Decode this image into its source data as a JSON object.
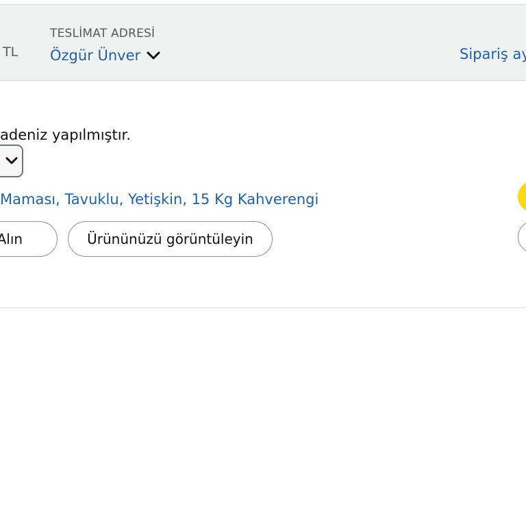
{
  "order_header": {
    "total_fragment": "TL",
    "ship_to_label": "TESLİMAT ADRESİ",
    "ship_to_name": "Özgür Ünver",
    "ship_to_icon": "chevron-down-icon",
    "order_details_link": "Sipariş ay"
  },
  "order_body": {
    "delivery_status": "adeniz yapılmıştır.",
    "quantity_dropdown_icon": "chevron-down-icon",
    "product_title": "Maması, Tavuklu, Yetişkin, 15 Kg Kahverengi",
    "buy_again_label": "ın Alın",
    "view_item_label": "Ürününüzü görüntüleyin"
  },
  "colors": {
    "link": "#2162a1",
    "header_bg": "#f0f2f2",
    "primary_button": "#ffd814",
    "text": "#0f1111",
    "muted_text": "#565959"
  }
}
